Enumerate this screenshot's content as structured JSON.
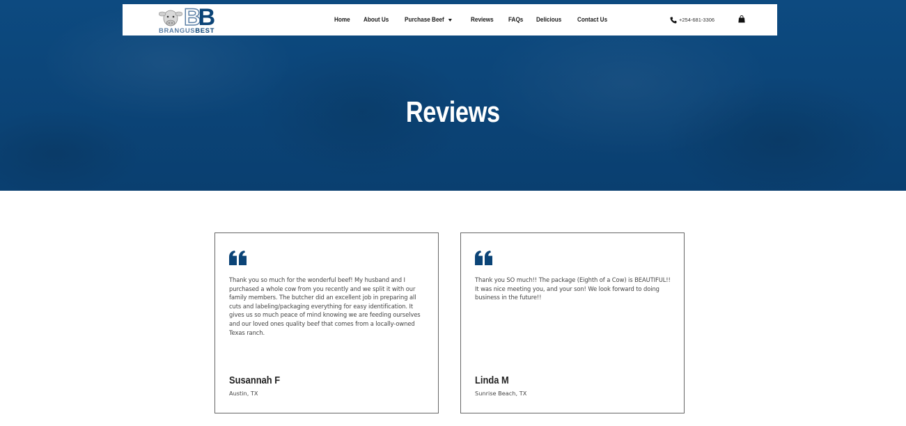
{
  "brand": {
    "logo_text_part1": "BRANGUS",
    "logo_text_part2": "BEST",
    "monogram_1": "B",
    "monogram_2": "B",
    "accent_color": "#0b4477",
    "secondary_color": "#5b7fa6"
  },
  "nav": {
    "items": [
      {
        "label": "Home"
      },
      {
        "label": "About Us"
      },
      {
        "label": "Purchase Beef",
        "has_dropdown": true
      },
      {
        "label": "Reviews"
      },
      {
        "label": "FAQs"
      },
      {
        "label": "Delicious"
      },
      {
        "label": "Contact Us"
      }
    ]
  },
  "header": {
    "phone": "+254-681-3306",
    "phone_icon": "phone-icon",
    "cart_icon": "shopping-bag-icon"
  },
  "hero": {
    "title": "Reviews"
  },
  "reviews": [
    {
      "text": "Thank you so much for the wonderful beef! My husband and I purchased a whole cow from you recently and we split it with our family members. The butcher did an excellent job in preparing all cuts and labeling/packaging everything for easy identification. It gives us so much peace of mind knowing we are feeding ourselves and our loved ones quality beef that comes from a locally-owned Texas ranch.",
      "name": "Susannah F",
      "location": "Austin, TX"
    },
    {
      "text": "Thank you SO much!! The package (Eighth of a Cow) is BEAUTIFUL!! It was nice meeting you, and your son! We look forward to doing business in the future!!",
      "name": "Linda M",
      "location": "Sunrise Beach, TX"
    }
  ]
}
